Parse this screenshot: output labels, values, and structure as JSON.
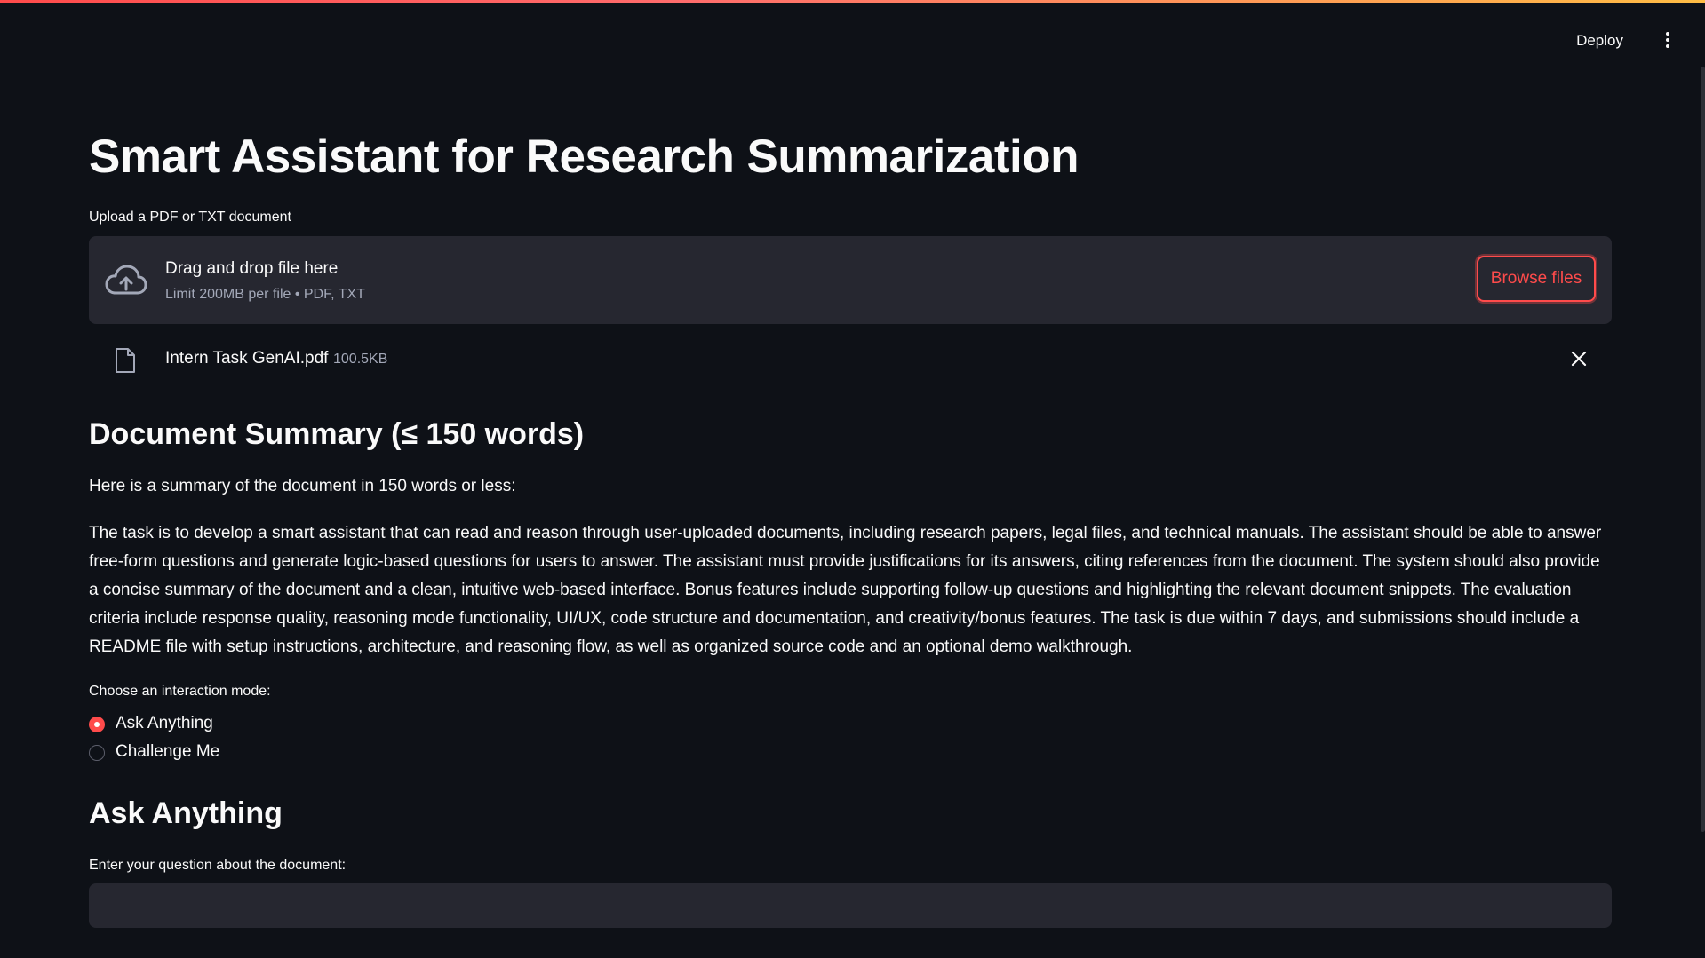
{
  "header": {
    "deploy_label": "Deploy",
    "menu_icon": "kebab-menu-icon"
  },
  "title": "Smart Assistant for Research Summarization",
  "uploader": {
    "label": "Upload a PDF or TXT document",
    "drop_title": "Drag and drop file here",
    "drop_limit": "Limit 200MB per file • PDF, TXT",
    "browse_label": "Browse files",
    "icon": "cloud-upload-icon"
  },
  "uploaded_file": {
    "name": "Intern Task GenAI.pdf",
    "size": "100.5KB",
    "icon": "file-icon",
    "remove_icon": "close-icon"
  },
  "summary": {
    "heading": "Document Summary (≤ 150 words)",
    "intro": "Here is a summary of the document in 150 words or less:",
    "body": "The task is to develop a smart assistant that can read and reason through user-uploaded documents, including research papers, legal files, and technical manuals. The assistant should be able to answer free-form questions and generate logic-based questions for users to answer. The assistant must provide justifications for its answers, citing references from the document. The system should also provide a concise summary of the document and a clean, intuitive web-based interface. Bonus features include supporting follow-up questions and highlighting the relevant document snippets. The evaluation criteria include response quality, reasoning mode functionality, UI/UX, code structure and documentation, and creativity/bonus features. The task is due within 7 days, and submissions should include a README file with setup instructions, architecture, and reasoning flow, as well as organized source code and an optional demo walkthrough."
  },
  "mode": {
    "label": "Choose an interaction mode:",
    "options": [
      {
        "label": "Ask Anything",
        "selected": true
      },
      {
        "label": "Challenge Me",
        "selected": false
      }
    ]
  },
  "ask": {
    "heading": "Ask Anything",
    "question_label": "Enter your question about the document:",
    "question_value": ""
  },
  "colors": {
    "background": "#0e1117",
    "panel": "#262730",
    "accent": "#ff4b4b",
    "text": "#fafafa",
    "muted_text": "#a3a8b8"
  }
}
